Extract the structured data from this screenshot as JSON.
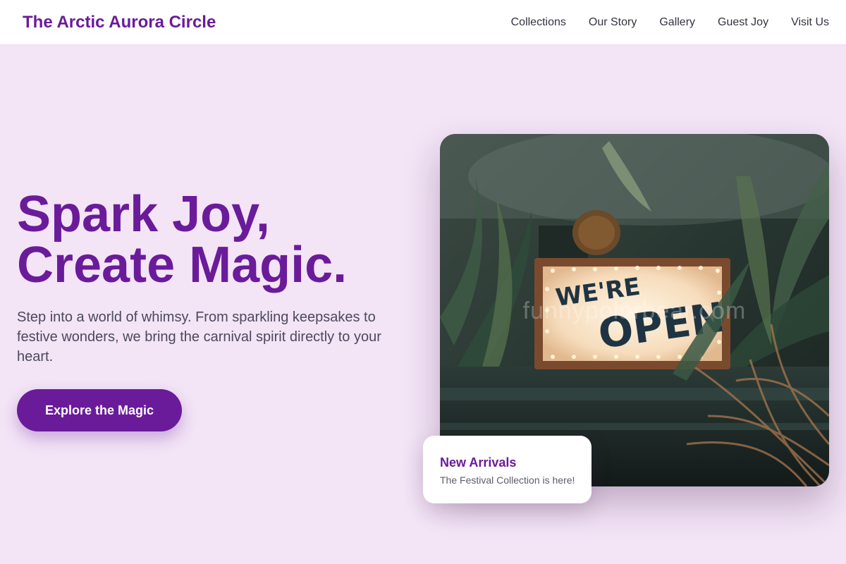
{
  "header": {
    "brand": "The Arctic Aurora Circle",
    "nav": [
      "Collections",
      "Our Story",
      "Gallery",
      "Guest Joy",
      "Visit Us"
    ]
  },
  "hero": {
    "title_line1": "Spark Joy,",
    "title_line2": "Create Magic.",
    "subtitle": "Step into a world of whimsy. From sparkling keepsakes to festive wonders, we bring the carnival spirit directly to your heart.",
    "cta_label": "Explore the Magic"
  },
  "photo": {
    "sign_line1": "WE'RE",
    "sign_line2": "OPEN",
    "watermark": "funnypolarbear.com"
  },
  "arrivals": {
    "title": "New Arrivals",
    "text": "The Festival Collection is here!"
  },
  "colors": {
    "accent": "#6a1b9a",
    "background": "#f3e4f6",
    "header": "#ffffff"
  }
}
